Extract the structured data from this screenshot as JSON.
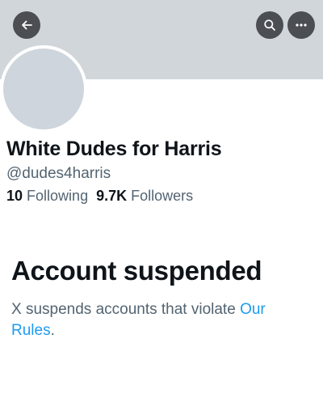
{
  "header": {
    "back_icon": "arrow-left-icon",
    "search_icon": "search-icon",
    "more_icon": "more-horizontal-icon"
  },
  "profile": {
    "display_name": "White Dudes for Harris",
    "handle": "@dudes4harris",
    "following_count": "10",
    "following_label": "Following",
    "followers_count": "9.7K",
    "followers_label": "Followers"
  },
  "suspension": {
    "title": "Account suspended",
    "message": "X suspends accounts that violate",
    "link_text": "Our Rules",
    "trailing": "."
  },
  "colors": {
    "banner": "#d1d6db",
    "avatar": "#ced5dc",
    "link": "#1d9bf0",
    "secondary_text": "#536471",
    "button_bg": "#4b4e52"
  }
}
